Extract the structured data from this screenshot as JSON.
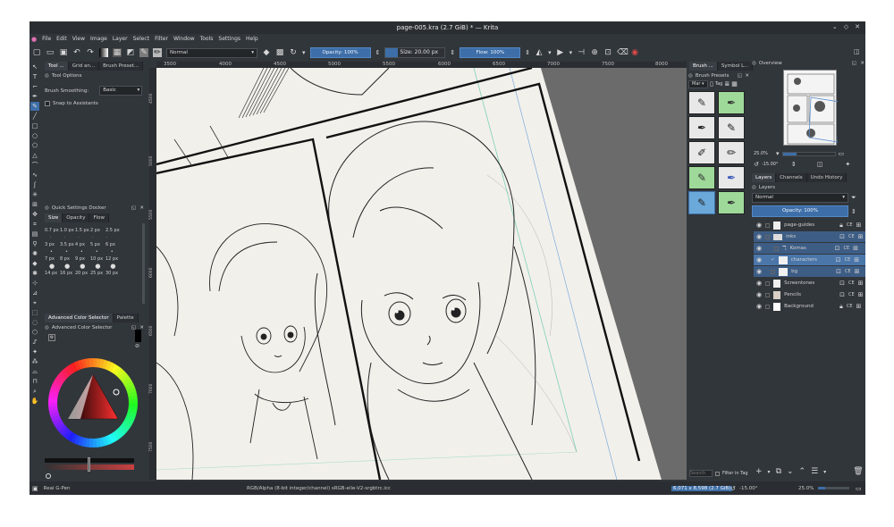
{
  "window": {
    "title": "page-005.kra (2.7 GiB) * — Krita"
  },
  "menu": [
    "File",
    "Edit",
    "View",
    "Image",
    "Layer",
    "Select",
    "Filter",
    "Window",
    "Tools",
    "Settings",
    "Help"
  ],
  "toolbar": {
    "blend_mode": "Normal",
    "opacity_label": "Opacity: 100%",
    "size_label": "Size: 20.00 px",
    "flow_label": "Flow: 100%"
  },
  "left_tabs": [
    "Tool ...",
    "Grid an...",
    "Brush Preset..."
  ],
  "tool_options": {
    "header": "Tool Options",
    "smoothing_label": "Brush Smoothing:",
    "smoothing_value": "Basic",
    "snap_label": "Snap to Assistants"
  },
  "quick_settings": {
    "header": "Quick Settings Docker",
    "tabs": [
      "Size",
      "Opacity",
      "Flow"
    ],
    "sizes": [
      [
        "0.7 px",
        "1.0 px",
        "1.5 px",
        "2 px",
        "2.5 px"
      ],
      [
        "3 px",
        "3.5 px",
        "4 px",
        "5 px",
        "6 px"
      ],
      [
        "7 px",
        "8 px",
        "9 px",
        "10 px",
        "12 px"
      ],
      [
        "14 px",
        "16 px",
        "20 px",
        "25 px",
        "30 px"
      ]
    ]
  },
  "color_tabs": [
    "Advanced Color Selector",
    "Palette"
  ],
  "color_selector": {
    "header": "Advanced Color Selector"
  },
  "ruler": {
    "ticks": [
      "3500",
      "4000",
      "4500",
      "5000",
      "5500",
      "6000",
      "6500",
      "7000",
      "7500",
      "8000"
    ]
  },
  "ruler_v": {
    "ticks": [
      "4500",
      "5000",
      "5500",
      "6000",
      "6500",
      "7000",
      "7500"
    ]
  },
  "brush_tabs": [
    "Brush ...",
    "Symbol L..."
  ],
  "brush_presets": {
    "header": "Brush Presets",
    "filter": "Mar",
    "tag_label": "Tag",
    "search_placeholder": "Search",
    "filter_tag": "Filter in Tag"
  },
  "overview": {
    "header": "Overview",
    "zoom": "25.0%",
    "rotation": "-15.00°"
  },
  "right_tabs": [
    "Layers",
    "Channels",
    "Undo History"
  ],
  "layers_panel": {
    "header": "Layers",
    "blend": "Normal",
    "opacity": "Opacity: 100%",
    "items": [
      {
        "name": "page-guides"
      },
      {
        "name": "inks"
      },
      {
        "name": "Komas"
      },
      {
        "name": "characters"
      },
      {
        "name": "bg"
      },
      {
        "name": "Screentones"
      },
      {
        "name": "Pencils"
      },
      {
        "name": "Background"
      }
    ]
  },
  "status": {
    "brush": "Real G-Pen",
    "colorspace": "RGB/Alpha (8-bit integer/channel)  sRGB-elle-V2-srgbtrc.icc",
    "dimensions": "6,071 x 8,598 (2.7 GiB)",
    "rotation": "-15.00°",
    "zoom": "25.0%"
  },
  "colors": {
    "accent": "#3d6ea8",
    "bg": "#31363b",
    "canvas": "#6b6b6b",
    "paper": "#f2f0eb"
  }
}
